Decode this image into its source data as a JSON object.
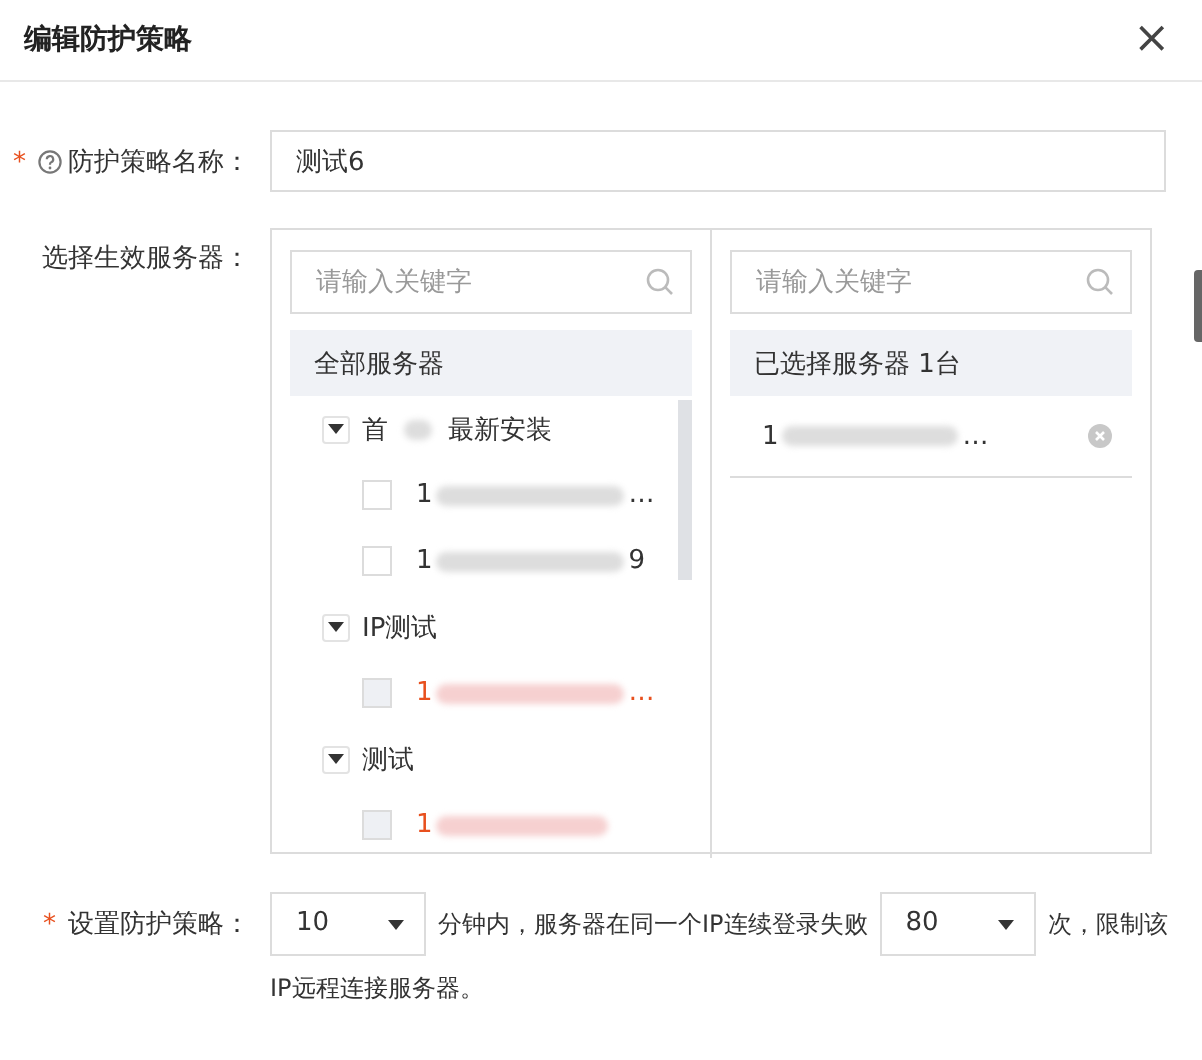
{
  "dialog": {
    "title": "编辑防护策略",
    "close": "×"
  },
  "name_field": {
    "required_mark": "*",
    "label": "防护策略名称：",
    "value": "测试6"
  },
  "server_picker": {
    "label": "选择生效服务器：",
    "source": {
      "placeholder": "请输入关键字",
      "header": "全部服务器",
      "groups": [
        {
          "label_parts": [
            "首",
            "最新安装"
          ],
          "expanded": true,
          "items": [
            {
              "lead": "1",
              "tail": "…",
              "disabled": false,
              "checked": false
            },
            {
              "lead": "1",
              "tail": "9",
              "disabled": false,
              "checked": false
            }
          ]
        },
        {
          "label_parts": [
            "IP测试"
          ],
          "expanded": true,
          "items": [
            {
              "lead": "1",
              "tail": "…",
              "disabled": true,
              "checked": false
            }
          ]
        },
        {
          "label_parts": [
            "测试"
          ],
          "expanded": true,
          "items": [
            {
              "lead": "1",
              "disabled": true,
              "checked": false
            }
          ]
        }
      ]
    },
    "target": {
      "placeholder": "请输入关键字",
      "header": "已选择服务器 1台",
      "items": [
        {
          "lead": "1",
          "tail": "…"
        }
      ]
    }
  },
  "policy": {
    "required_mark": "*",
    "label": "设置防护策略：",
    "minutes": "10",
    "text_1": "分钟内，服务器在同一个IP连续登录失败",
    "attempts": "80",
    "text_2": "次，限制该",
    "text_3": "IP远程连接服务器。"
  }
}
